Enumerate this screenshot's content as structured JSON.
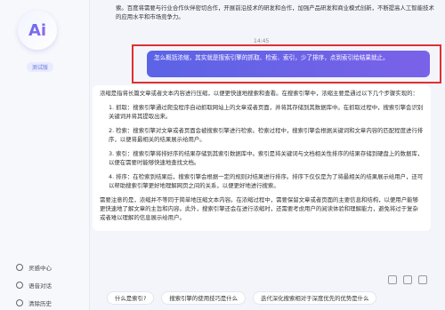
{
  "sidebar": {
    "logo_text": "Ai",
    "badge": "测试版",
    "items": [
      {
        "label": "灵感中心"
      },
      {
        "label": "语音对话"
      },
      {
        "label": "清除历史"
      }
    ]
  },
  "chat": {
    "intro_text": "索。百度将需要与行业合作伙伴密切合作，开展前沿技术的研发和合作，加强产品研发和商业模式创新，不断提高人工智能技术的应用水平和市场竞争力。",
    "timestamp": "14:45",
    "user_message": "怎么概括浓缩，其实就是搜索引擎的抓取、检索、索引，少了排序，点到索引给结果就止。",
    "answer_intro": "浓缩是指将长篇文章或者文本内容进行压缩，以便更快速地搜索和查看。在搜索引擎中，浓缩主要是通过以下几个步骤实现的：",
    "answer_items": [
      "1. 抓取：搜索引擎通过爬虫程序自动抓取网站上的文章或者页面，并将其存储到其数据库中。在抓取过程中，搜索引擎会识别关键词并将其提取出来。",
      "2. 检索：搜索引擎对文章或者页面会被搜索引擎进行检索。检索过程中，搜索引擎会根据关键词和文章内容的匹配程度进行排序，以便将最相关的结果展示给用户。",
      "3. 索引：搜索引擎将排好序的结果存储到其索引数据库中。索引是将关键词与文档相关性排序的结果存储到硬盘上的数据库，以便在需要时能够快速地查找文档。",
      "4. 排序：在检索到结果后，搜索引擎会根据一定的规则对结果进行排序。排序下仅仅是为了将最相关的结果展示给用户，还可以帮助搜索引擎更好地理解网页之间的关系，以便更好地进行搜索。"
    ],
    "answer_outro": "需要注意的是，浓缩并不等同于简单地压缩文本内容。在浓缩过程中，需要保留文章或者页面的主要信息和结构，以便用户能够更快速地了解文章的主旨和内容。此外，搜索引擎还会在进行浓缩时，还需要考虑用户的阅读体验和理解能力，避免将过于复杂或者难以理解的信息展示给用户。"
  },
  "suggestions": [
    "什么是索引?",
    "搜索引擎的使用技巧是什么",
    "迭代深化搜索相对于深度优先的优势是什么"
  ]
}
